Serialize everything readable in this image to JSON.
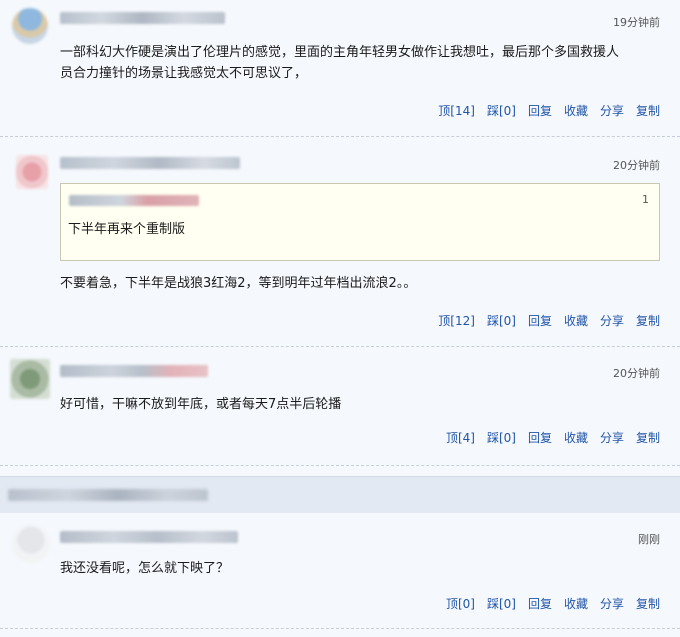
{
  "comments": [
    {
      "time": "19分钟前",
      "content_line1": "一部科幻大作硬是演出了伦理片的感觉，里面的主角年轻男女做作让我想吐，最后那个多国救援人",
      "content_line2": "员合力撞针的场景让我感觉太不可思议了，",
      "actions": {
        "up": "顶[14]",
        "down": "踩[0]",
        "reply": "回复",
        "fav": "收藏",
        "share": "分享",
        "copy": "复制"
      }
    },
    {
      "time": "20分钟前",
      "quote": {
        "number": "1",
        "text": "下半年再来个重制版"
      },
      "content_line1": "不要着急，下半年是战狼3红海2，等到明年过年档出流浪2。。",
      "actions": {
        "up": "顶[12]",
        "down": "踩[0]",
        "reply": "回复",
        "fav": "收藏",
        "share": "分享",
        "copy": "复制"
      }
    },
    {
      "time": "20分钟前",
      "content_line1": "好可惜，干嘛不放到年底，或者每天7点半后轮播",
      "actions": {
        "up": "顶[4]",
        "down": "踩[0]",
        "reply": "回复",
        "fav": "收藏",
        "share": "分享",
        "copy": "复制"
      }
    },
    {
      "time": "刚刚",
      "content_line1": "我还没看呢，怎么就下映了？",
      "actions": {
        "up": "顶[0]",
        "down": "踩[0]",
        "reply": "回复",
        "fav": "收藏",
        "share": "分享",
        "copy": "复制"
      }
    }
  ]
}
